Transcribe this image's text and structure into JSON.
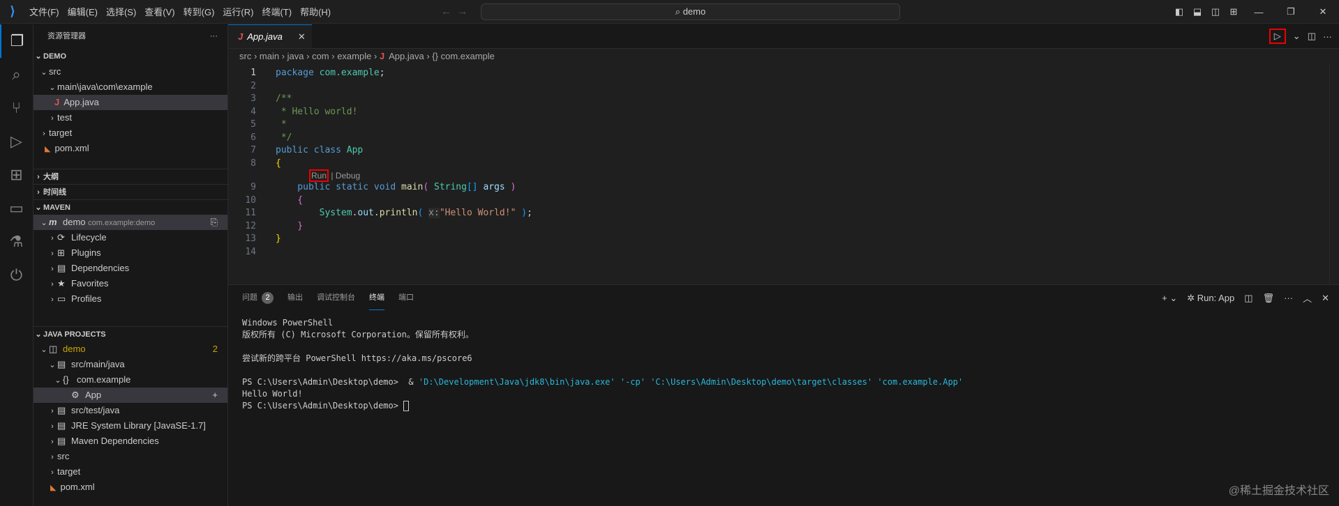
{
  "menu": [
    "文件(F)",
    "编辑(E)",
    "选择(S)",
    "查看(V)",
    "转到(G)",
    "运行(R)",
    "终端(T)",
    "帮助(H)"
  ],
  "search": "demo",
  "explorer": {
    "title": "资源管理器",
    "root": "DEMO",
    "items": [
      "src",
      "main\\java\\com\\example",
      "App.java",
      "test",
      "target",
      "pom.xml"
    ]
  },
  "sections": {
    "outline": "大纲",
    "timeline": "时间线",
    "maven": "MAVEN",
    "java": "JAVA PROJECTS"
  },
  "maven": {
    "project": "demo",
    "artifact": "com.example:demo",
    "items": [
      "Lifecycle",
      "Plugins",
      "Dependencies",
      "Favorites",
      "Profiles"
    ]
  },
  "java": {
    "project": "demo",
    "problems": "2",
    "items": [
      "src/main/java",
      "com.example",
      "App",
      "src/test/java",
      "JRE System Library [JavaSE-1.7]",
      "Maven Dependencies",
      "src",
      "target",
      "pom.xml"
    ]
  },
  "tab": "App.java",
  "breadcrumbs": [
    "src",
    "main",
    "java",
    "com",
    "example",
    "App.java",
    "com.example"
  ],
  "codelens": {
    "run": "Run",
    "sep": "|",
    "debug": "Debug"
  },
  "code": [
    [
      [
        "package ",
        "kw"
      ],
      [
        "com.example",
        "ns"
      ],
      [
        ";",
        "pl"
      ]
    ],
    [],
    [
      [
        "/**",
        "cm"
      ]
    ],
    [
      [
        " * Hello world!",
        "cm"
      ]
    ],
    [
      [
        " *",
        "cm"
      ]
    ],
    [
      [
        " */",
        "cm"
      ]
    ],
    [
      [
        "public ",
        "kw"
      ],
      [
        "class ",
        "kw"
      ],
      [
        "App",
        "ty"
      ]
    ],
    [
      [
        "{",
        "br"
      ]
    ],
    [
      [
        "    public ",
        "kw"
      ],
      [
        "static ",
        "kw"
      ],
      [
        "void ",
        "kw"
      ],
      [
        "main",
        "fn"
      ],
      [
        "( ",
        "br2"
      ],
      [
        "String",
        "ty"
      ],
      [
        "[]",
        "br3"
      ],
      [
        " args ",
        "pv"
      ],
      [
        ")",
        "br2"
      ]
    ],
    [
      [
        "    {",
        "br2"
      ]
    ],
    [
      [
        "        System",
        "ns"
      ],
      [
        ".",
        "pl"
      ],
      [
        "out",
        "pv"
      ],
      [
        ".",
        "pl"
      ],
      [
        "println",
        "fn"
      ],
      [
        "( ",
        "br3"
      ],
      [
        "x:",
        "hint"
      ],
      [
        "\"Hello World!\"",
        "st"
      ],
      [
        " )",
        "br3"
      ],
      [
        ";",
        "pl"
      ]
    ],
    [
      [
        "    }",
        "br2"
      ]
    ],
    [
      [
        "}",
        "br"
      ]
    ],
    []
  ],
  "panel": {
    "tabs": [
      "问题",
      "输出",
      "调试控制台",
      "终端",
      "端口"
    ],
    "problems_count": "2",
    "run_label": "Run: App"
  },
  "terminal": [
    [
      [
        "Windows PowerShell",
        ""
      ]
    ],
    [
      [
        "版权所有 (C) Microsoft Corporation。保留所有权利。",
        ""
      ]
    ],
    [],
    [
      [
        "尝试新的跨平台 PowerShell https://aka.ms/pscore6",
        ""
      ]
    ],
    [],
    [
      [
        "PS C:\\Users\\Admin\\Desktop\\demo>  & ",
        ""
      ],
      [
        "'D:\\Development\\Java\\jdk8\\bin\\java.exe' '-cp' 'C:\\Users\\Admin\\Desktop\\demo\\target\\classes' 'com.example.App'",
        "cy"
      ]
    ],
    [
      [
        "Hello World!",
        ""
      ]
    ],
    [
      [
        "PS C:\\Users\\Admin\\Desktop\\demo> ",
        ""
      ]
    ]
  ],
  "watermark": "@稀土掘金技术社区"
}
